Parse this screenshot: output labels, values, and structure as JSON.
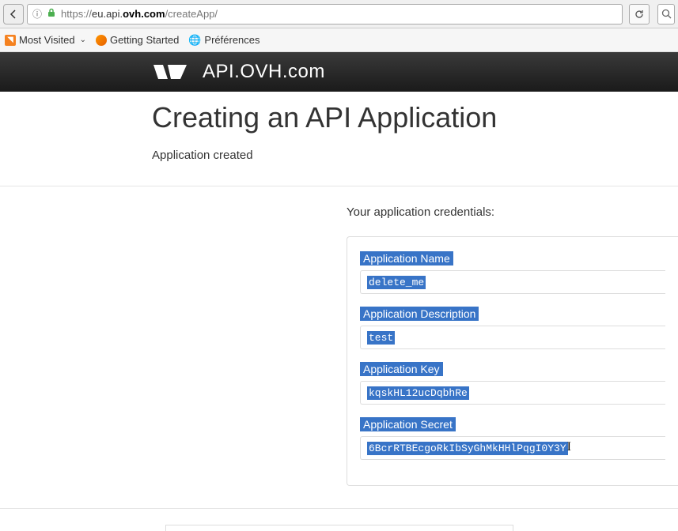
{
  "browser": {
    "url_proto": "https://",
    "url_sub": "eu.api.",
    "url_domain": "ovh.com",
    "url_path": "/createApp/",
    "bookmarks": {
      "most_visited": "Most Visited",
      "getting_started": "Getting Started",
      "preferences": "Préférences"
    }
  },
  "header": {
    "brand": "API.OVH.com"
  },
  "page": {
    "title": "Creating an API Application",
    "subtitle": "Application created",
    "cred_intro": "Your application credentials:"
  },
  "credentials": {
    "name_label": "Application Name",
    "name_value": "delete_me",
    "desc_label": "Application Description",
    "desc_value": "test",
    "key_label": "Application Key",
    "key_value": "kqskHL12ucDqbhRe",
    "secret_label": "Application Secret",
    "secret_value": "6BcrRTBEcgoRkIbSyGhMkHHlPqgI0Y3Y"
  }
}
